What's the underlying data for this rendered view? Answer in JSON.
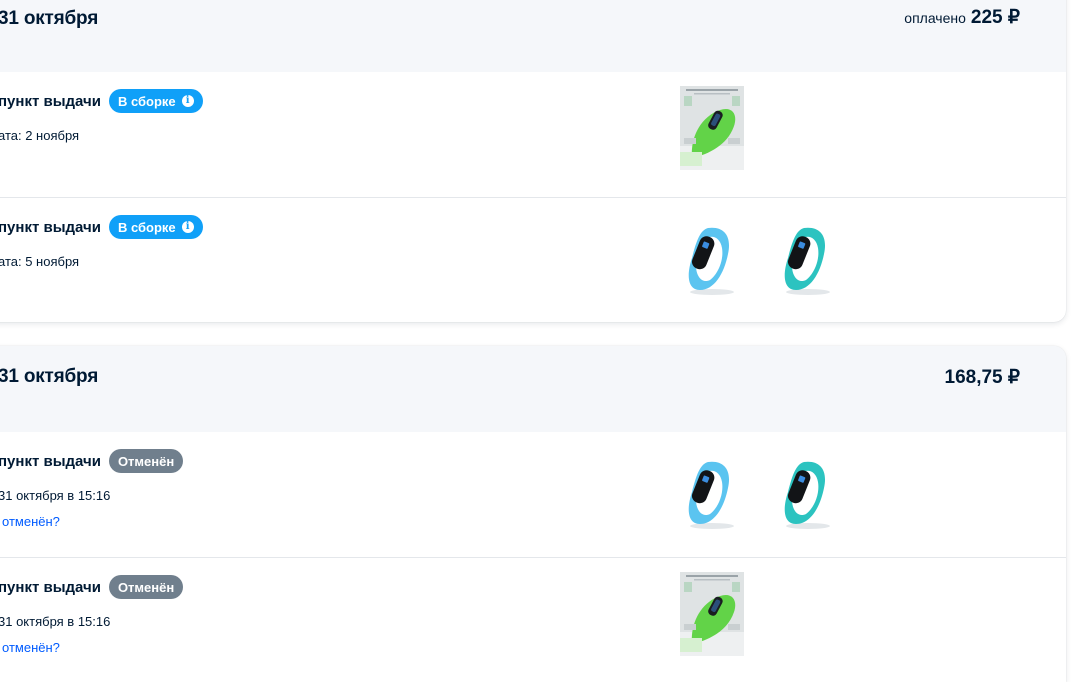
{
  "orders": [
    {
      "date": "31 октября",
      "paid_label": "оплачено",
      "total": "225 ₽",
      "shipments": [
        {
          "title": "пункт выдачи",
          "status": "В сборке",
          "status_type": "assembling",
          "line": "ата: 2 ноября",
          "products": [
            "product-box-green-band"
          ]
        },
        {
          "title": "пункт выдачи",
          "status": "В сборке",
          "status_type": "assembling",
          "line": "ата: 5 ноября",
          "products": [
            "fitness-band-blue",
            "fitness-band-teal"
          ]
        }
      ]
    },
    {
      "date": "31 октября",
      "paid_label": "",
      "total": "168,75 ₽",
      "shipments": [
        {
          "title": "пункт выдачи",
          "status": "Отменён",
          "status_type": "cancelled",
          "line": "31 октября в 15:16",
          "cancel_link": "отменён?",
          "products": [
            "fitness-band-blue",
            "fitness-band-teal"
          ]
        },
        {
          "title": "пункт выдачи",
          "status": "Отменён",
          "status_type": "cancelled",
          "line": "31 октября в 15:16",
          "cancel_link": "отменён?",
          "products": [
            "product-box-green-band"
          ]
        }
      ]
    }
  ],
  "colors": {
    "assembling": "#10a0f8",
    "cancelled": "#707f8d",
    "link": "#005bff",
    "header_bg": "#f5f7fa",
    "blue_band": "#5bc4f0",
    "teal_band": "#2cc3c0",
    "green_band": "#62d348"
  }
}
